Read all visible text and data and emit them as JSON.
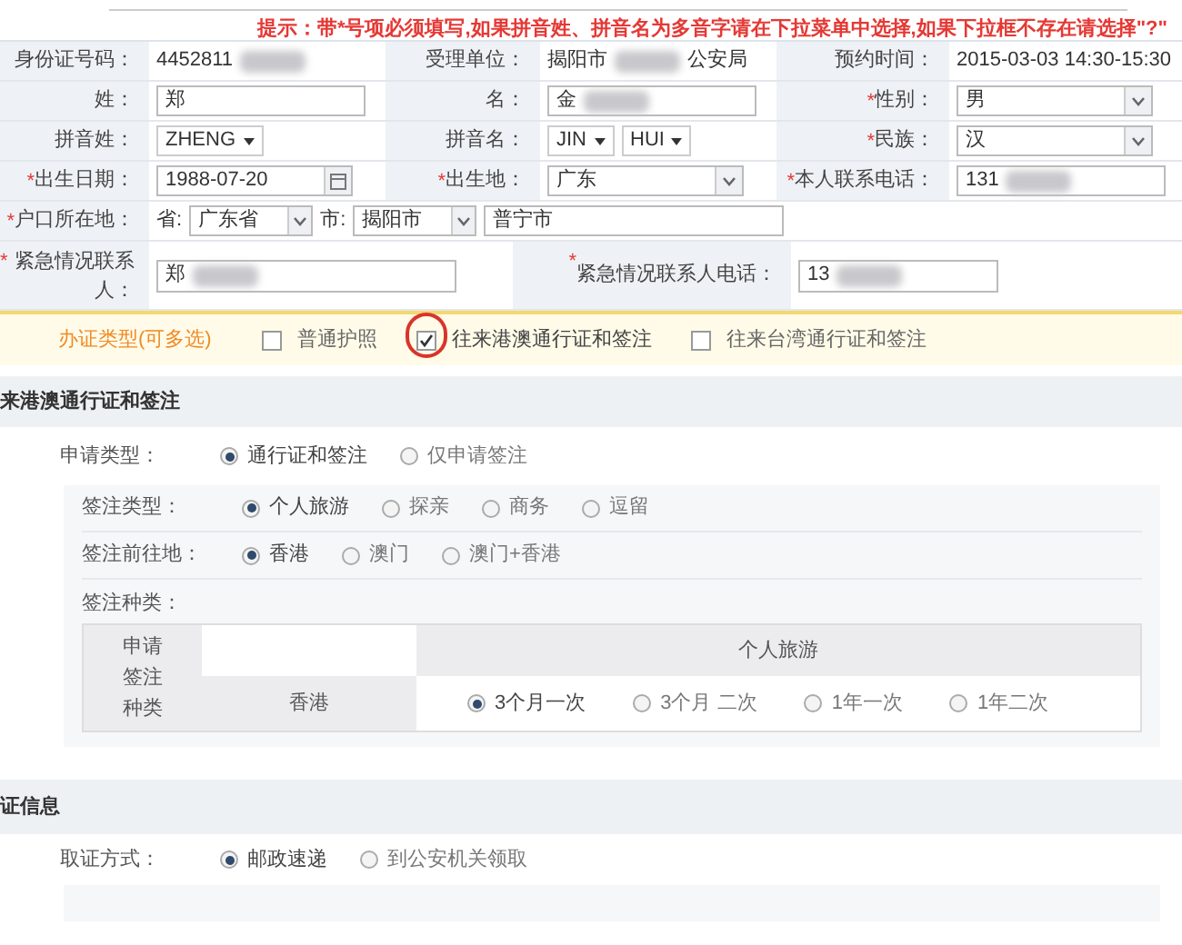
{
  "hint": "提示：带*号项必须填写,如果拼音姓、拼音名为多音字请在下拉菜单中选择,如果下拉框不存在请选择\"?\"",
  "form_rows": [
    [
      {
        "label": "身份证号码：",
        "kind": "static",
        "value": "4452811",
        "redacted": true
      },
      {
        "label": "受理单位：",
        "kind": "static",
        "value": "揭阳市",
        "redacted": true,
        "value_end": "公安局"
      },
      {
        "label": "预约时间：",
        "kind": "static",
        "value": "2015-03-03  14:30-15:30"
      }
    ],
    [
      {
        "label": "姓：",
        "kind": "input",
        "value": "郑"
      },
      {
        "label": "名：",
        "kind": "input",
        "value": "金",
        "redacted": true
      },
      {
        "required_mark": "*",
        "label": "性别：",
        "kind": "select",
        "value": "男"
      }
    ],
    [
      {
        "label": "拼音姓：",
        "kind": "pinyin",
        "options": [
          "ZHENG"
        ]
      },
      {
        "label": "拼音名：",
        "kind": "pinyin",
        "options": [
          "JIN",
          "HUI"
        ]
      },
      {
        "required_mark": "*",
        "label": "民族：",
        "kind": "select",
        "value": "汉"
      }
    ],
    [
      {
        "required_mark": "*",
        "label": "出生日期：",
        "kind": "date",
        "value": "1988-07-20"
      },
      {
        "required_mark": "*",
        "label": "出生地：",
        "kind": "select",
        "value": "广东"
      },
      {
        "required_mark": "*",
        "label": "本人联系电话：",
        "kind": "input",
        "value": "131",
        "redacted": true
      }
    ]
  ],
  "residence": {
    "required_mark": "*",
    "label": "户口所在地：",
    "province_label": "省:",
    "province": "广东省",
    "city_label": "市:",
    "city": "揭阳市",
    "county": "普宁市"
  },
  "emergency": [
    {
      "required_mark": "*",
      "label": "紧急情况联系人：",
      "value": "郑",
      "redacted": true
    },
    {
      "required_mark": "*",
      "label": "紧急情况联系人电话：",
      "value": "13",
      "redacted": true
    }
  ],
  "permit_types": {
    "label": "办证类型(可多选)",
    "options": [
      {
        "label": "普通护照",
        "checked": false,
        "circled": false
      },
      {
        "label": "往来港澳通行证和签注",
        "checked": true,
        "circled": true
      },
      {
        "label": "往来台湾通行证和签注",
        "checked": false,
        "circled": false
      }
    ]
  },
  "section_1": {
    "title": "来港澳通行证和签注",
    "apply_type": {
      "label": "申请类型：",
      "options": [
        {
          "label": "通行证和签注",
          "selected": true
        },
        {
          "label": "仅申请签注",
          "selected": false
        }
      ]
    },
    "visa_groups": [
      {
        "label": "签注类型：",
        "options": [
          {
            "label": "个人旅游",
            "selected": true
          },
          {
            "label": "探亲",
            "selected": false
          },
          {
            "label": "商务",
            "selected": false
          },
          {
            "label": "逗留",
            "selected": false
          }
        ]
      },
      {
        "label": "签注前往地：",
        "options": [
          {
            "label": "香港",
            "selected": true
          },
          {
            "label": "澳门",
            "selected": false
          },
          {
            "label": "澳门+香港",
            "selected": false
          }
        ]
      }
    ],
    "visa_kind_label": "签注种类：",
    "visa_table": {
      "row_header": "申请签注种类",
      "column_header": "个人旅游",
      "destination": "香港",
      "options": [
        {
          "label": "3个月一次",
          "selected": true
        },
        {
          "label": "3个月 二次",
          "selected": false
        },
        {
          "label": "1年一次",
          "selected": false
        },
        {
          "label": "1年二次",
          "selected": false
        }
      ]
    }
  },
  "section_2": {
    "title": "证信息",
    "pickup": {
      "label": "取证方式：",
      "options": [
        {
          "label": "邮政速递",
          "selected": true
        },
        {
          "label": "到公安机关领取",
          "selected": false
        }
      ]
    }
  }
}
